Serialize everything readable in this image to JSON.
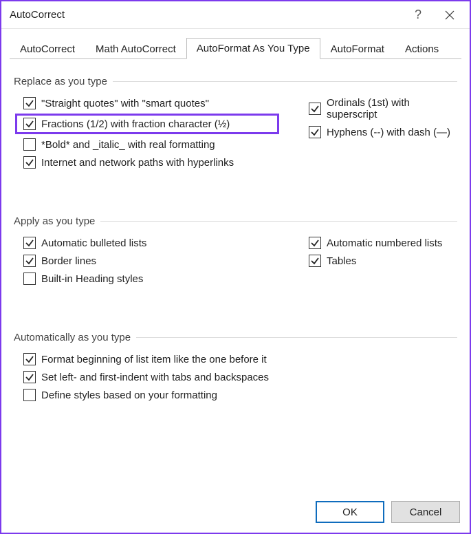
{
  "window": {
    "title": "AutoCorrect"
  },
  "tabs": {
    "items": [
      {
        "label": "AutoCorrect",
        "active": false
      },
      {
        "label": "Math AutoCorrect",
        "active": false
      },
      {
        "label": "AutoFormat As You Type",
        "active": true
      },
      {
        "label": "AutoFormat",
        "active": false
      },
      {
        "label": "Actions",
        "active": false
      }
    ]
  },
  "groups": {
    "replace": {
      "title": "Replace as you type",
      "left": [
        {
          "label": "\"Straight quotes\" with \"smart quotes\"",
          "checked": true,
          "name": "straight-quotes"
        },
        {
          "label": "Fractions (1/2) with fraction character (½)",
          "checked": true,
          "name": "fractions",
          "highlight": true
        },
        {
          "label": "*Bold* and _italic_ with real formatting",
          "checked": false,
          "name": "bold-italic"
        },
        {
          "label": "Internet and network paths with hyperlinks",
          "checked": true,
          "name": "hyperlinks"
        }
      ],
      "right": [
        {
          "label": "Ordinals (1st) with superscript",
          "checked": true,
          "name": "ordinals"
        },
        {
          "label": "Hyphens (--) with dash (—)",
          "checked": true,
          "name": "hyphens"
        }
      ]
    },
    "apply": {
      "title": "Apply as you type",
      "left": [
        {
          "label": "Automatic bulleted lists",
          "checked": true,
          "name": "bulleted-lists"
        },
        {
          "label": "Border lines",
          "checked": true,
          "name": "border-lines"
        },
        {
          "label": "Built-in Heading styles",
          "checked": false,
          "name": "heading-styles"
        }
      ],
      "right": [
        {
          "label": "Automatic numbered lists",
          "checked": true,
          "name": "numbered-lists"
        },
        {
          "label": "Tables",
          "checked": true,
          "name": "tables"
        }
      ]
    },
    "auto": {
      "title": "Automatically as you type",
      "items": [
        {
          "label": "Format beginning of list item like the one before it",
          "checked": true,
          "name": "format-list-item"
        },
        {
          "label": "Set left- and first-indent with tabs and backspaces",
          "checked": true,
          "name": "set-indent"
        },
        {
          "label": "Define styles based on your formatting",
          "checked": false,
          "name": "define-styles"
        }
      ]
    }
  },
  "footer": {
    "ok": "OK",
    "cancel": "Cancel"
  }
}
